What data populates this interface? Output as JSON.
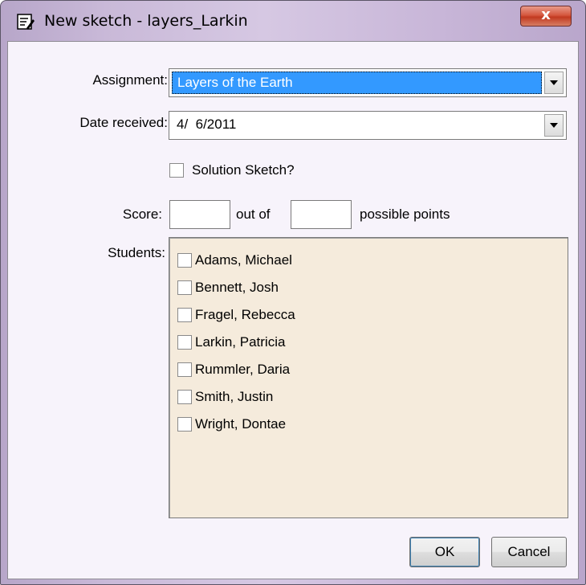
{
  "window": {
    "title": "New sketch - layers_Larkin",
    "close_label": "x"
  },
  "form": {
    "assignment_label": "Assignment:",
    "assignment_value": "Layers of the Earth",
    "date_label": "Date received:",
    "date_value": "4/  6/2011",
    "solution_label": "Solution Sketch?",
    "score_label": "Score:",
    "score_value": "",
    "out_of_label": "out of",
    "possible_value": "",
    "possible_label": "possible points",
    "students_label": "Students:"
  },
  "students": [
    "Adams, Michael",
    "Bennett, Josh",
    "Fragel, Rebecca",
    "Larkin, Patricia",
    "Rummler, Daria",
    "Smith, Justin",
    "Wright, Dontae"
  ],
  "buttons": {
    "ok": "OK",
    "cancel": "Cancel"
  },
  "colors": {
    "selection": "#3399ff",
    "list_background": "#f5ebdc",
    "close_button": "#c23a20"
  }
}
